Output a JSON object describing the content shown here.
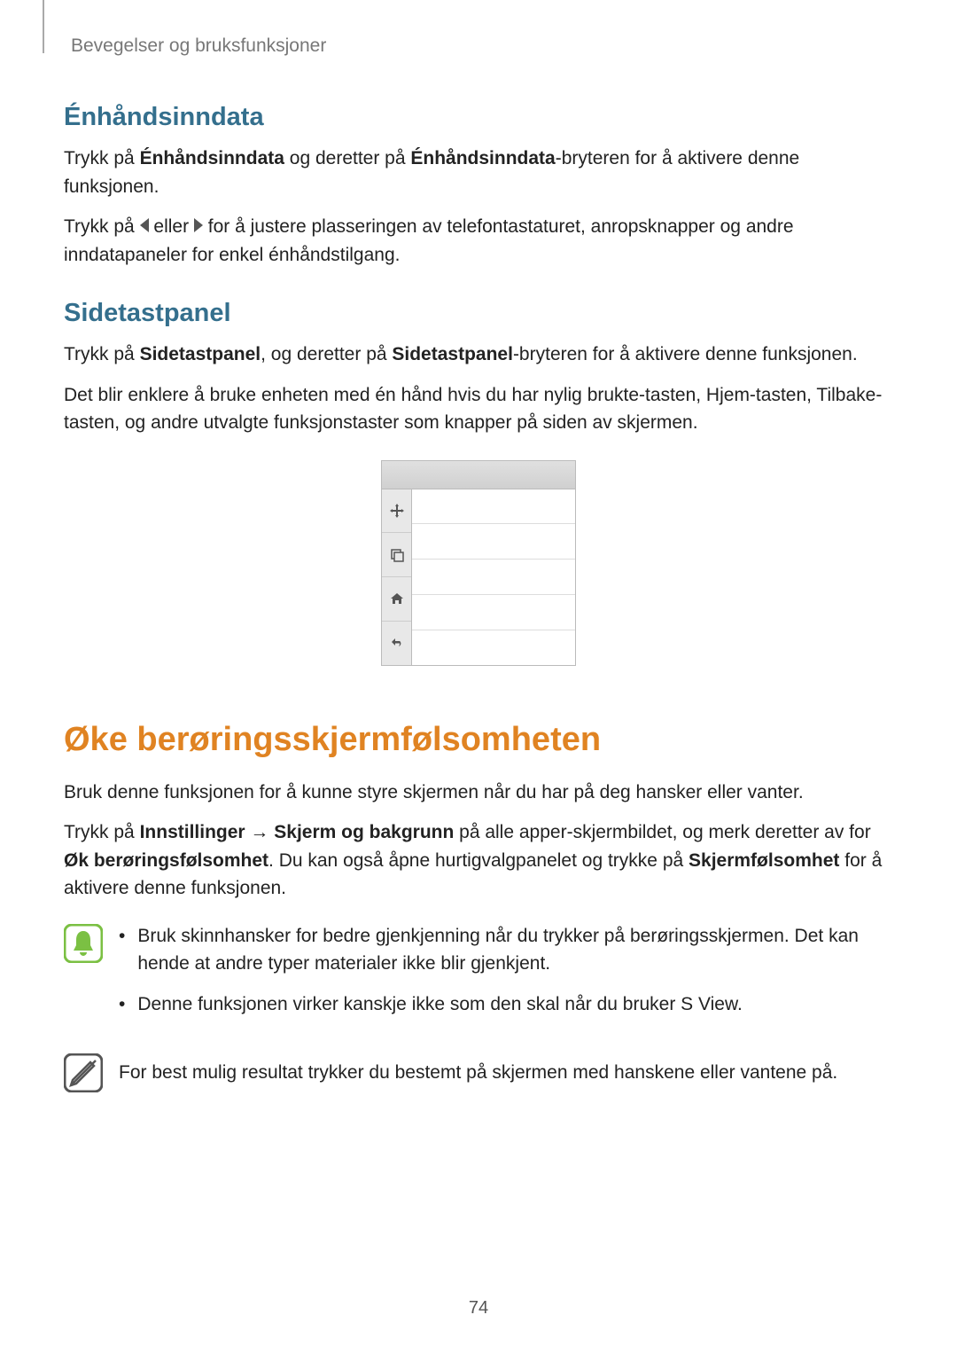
{
  "breadcrumb": "Bevegelser og bruksfunksjoner",
  "s1": {
    "heading": "Énhåndsinndata",
    "p1_a": "Trykk på ",
    "p1_b": "Énhåndsinndata",
    "p1_c": " og deretter på ",
    "p1_d": "Énhåndsinndata",
    "p1_e": "-bryteren for å aktivere denne funksjonen.",
    "p2_a": "Trykk på ",
    "p2_b": " eller ",
    "p2_c": " for å justere plasseringen av telefontastaturet, anropsknapper og andre inndatapaneler for enkel énhåndstilgang."
  },
  "s2": {
    "heading": "Sidetastpanel",
    "p1_a": "Trykk på ",
    "p1_b": "Sidetastpanel",
    "p1_c": ", og deretter på ",
    "p1_d": "Sidetastpanel",
    "p1_e": "-bryteren for å aktivere denne funksjonen.",
    "p2": "Det blir enklere å bruke enheten med én hånd hvis du har nylig brukte-tasten, Hjem-tasten, Tilbake-tasten, og andre utvalgte funksjonstaster som knapper på siden av skjermen."
  },
  "s3": {
    "heading": "Øke berøringsskjermfølsomheten",
    "p1": "Bruk denne funksjonen for å kunne styre skjermen når du har på deg hansker eller vanter.",
    "p2_a": "Trykk på ",
    "p2_b": "Innstillinger",
    "p2_arrow": " → ",
    "p2_c": "Skjerm og bakgrunn",
    "p2_d": " på alle apper-skjermbildet, og merk deretter av for ",
    "p2_e": "Øk berøringsfølsomhet",
    "p2_f": ". Du kan også åpne hurtigvalgpanelet og trykke på ",
    "p2_g": "Skjermfølsomhet",
    "p2_h": " for å aktivere denne funksjonen.",
    "tip1_b1": "Bruk skinnhansker for bedre gjenkjenning når du trykker på berøringsskjermen. Det kan hende at andre typer materialer ikke blir gjenkjent.",
    "tip1_b2": "Denne funksjonen virker kanskje ikke som den skal når du bruker S View.",
    "tip2": "For best mulig resultat trykker du bestemt på skjermen med hanskene eller vantene på."
  },
  "bullet": "•",
  "page_number": "74"
}
